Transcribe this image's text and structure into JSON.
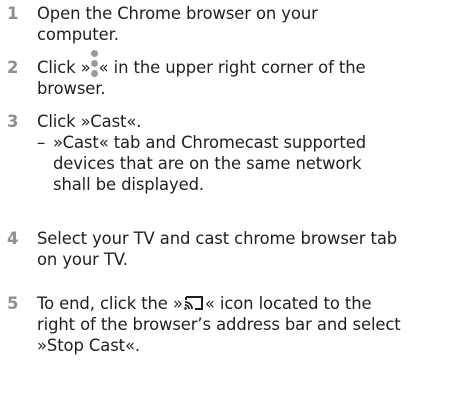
{
  "steps": [
    {
      "number": "1",
      "lines": [
        "Open the Chrome browser on your",
        "computer."
      ]
    },
    {
      "number": "2",
      "before_icon": "Click »",
      "icon": "three-dots-vertical-icon",
      "after_icon": "« in the upper right corner of the",
      "line2": "browser."
    },
    {
      "number": "3",
      "line1": "Click »Cast«.",
      "sub_dash": "–",
      "sub_lines": [
        "»Cast« tab and Chromecast supported",
        "devices that are on the same network",
        "shall be displayed."
      ]
    },
    {
      "number": "4",
      "lines": [
        "Select your TV and cast chrome browser tab",
        "on your TV."
      ]
    },
    {
      "number": "5",
      "before_icon": "To end, click the »",
      "icon": "cast-icon",
      "after_icon": "« icon located to the",
      "line2": "right of the browser’s address bar and select",
      "line3": "»Stop Cast«."
    }
  ],
  "colors": {
    "number": "#8f8f8f",
    "text": "#1f1f1f",
    "icon": "#9a9a9a"
  }
}
